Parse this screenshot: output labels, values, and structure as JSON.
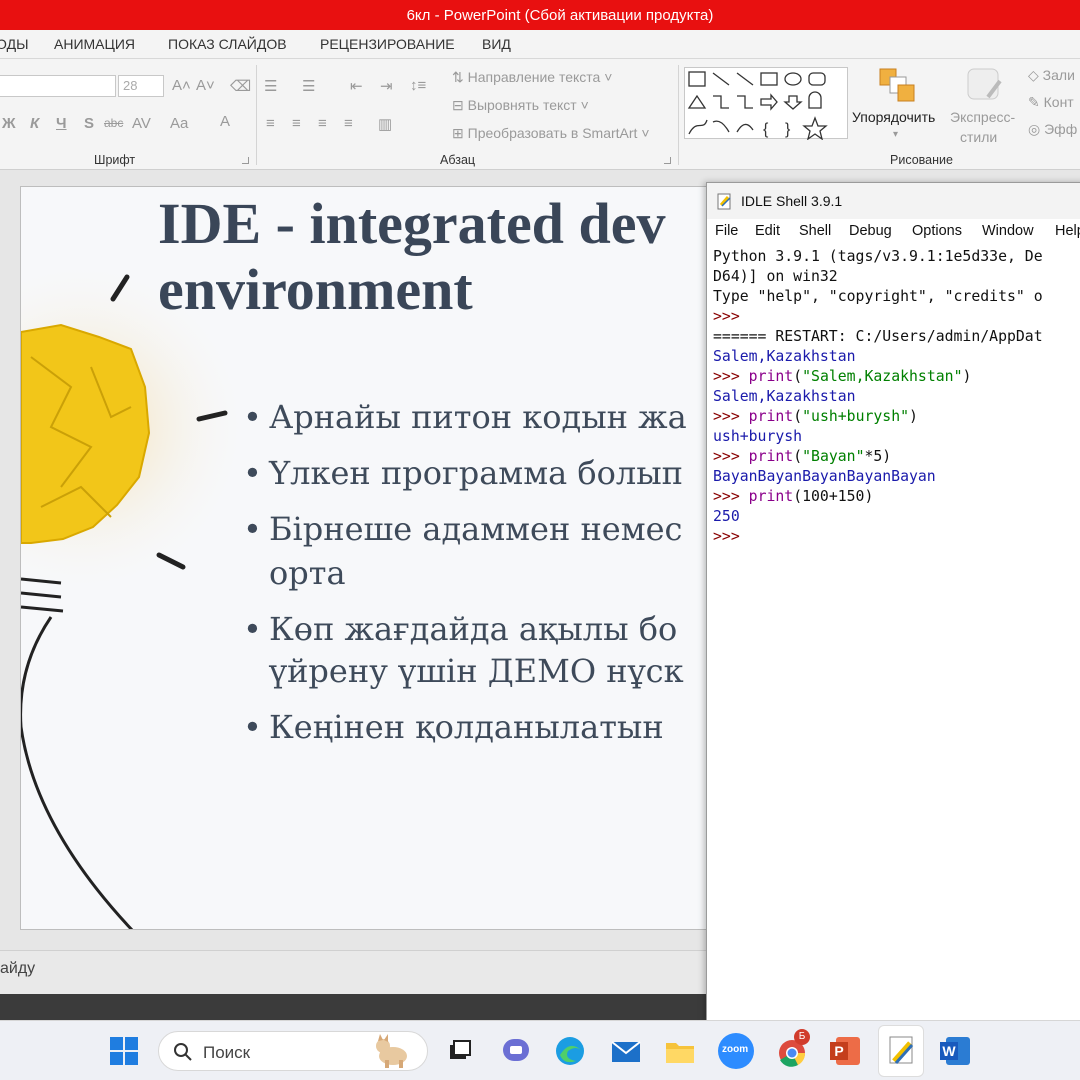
{
  "window_title": "6кл - PowerPoint (Сбой активации продукта)",
  "ribbon_tabs": [
    "ОДЫ",
    "АНИМАЦИЯ",
    "ПОКАЗ СЛАЙДОВ",
    "РЕЦЕНЗИРОВАНИЕ",
    "ВИД"
  ],
  "ribbon": {
    "font_group_label": "Шрифт",
    "font_size": "28",
    "paragraph_group_label": "Абзац",
    "text_direction": "Направление текста",
    "align_text": "Выровнять текст",
    "convert_smartart": "Преобразовать в SmartArt",
    "arrange": "Упорядочить",
    "quick_styles_1": "Экспресс-",
    "quick_styles_2": "стили",
    "drawing_group_label": "Рисование",
    "fill": "Зали",
    "outline": "Конт",
    "effects": "Эфф"
  },
  "slide": {
    "title_line1": "IDE - integrated dev",
    "title_line2": "environment",
    "bullets": [
      "Арнайы питон кодын жа",
      "Үлкен программа болып",
      "Бірнеше адаммен немес",
      "орта",
      "Көп жағдайда ақылы бо",
      "үйрену үшін ДЕМО нұск",
      "Кеңінен қолданылатын"
    ]
  },
  "status_bar": {
    "text": "айду"
  },
  "idle": {
    "title": "IDLE Shell 3.9.1",
    "menu": [
      "File",
      "Edit",
      "Shell",
      "Debug",
      "Options",
      "Window",
      "Help"
    ],
    "banner_1": "Python 3.9.1 (tags/v3.9.1:1e5d33e, De",
    "banner_2": "D64)] on win32",
    "banner_3": "Type \"help\", \"copyright\", \"credits\" o",
    "prompt": ">>>",
    "restart": "====== RESTART: C:/Users/admin/AppDat",
    "output_1": "Salem,Kazakhstan",
    "cmd_1_fn": "print",
    "cmd_1_str": "\"Salem,Kazakhstan\"",
    "output_2": "Salem,Kazakhstan",
    "cmd_2_str": "\"ush+burysh\"",
    "output_3": "ush+burysh",
    "cmd_3_str": "\"Bayan\"",
    "cmd_3_rest": "*5)",
    "output_4": "BayanBayanBayanBayanBayan",
    "cmd_4_rest": "(100+150)",
    "output_5": "250"
  },
  "taskbar": {
    "search_placeholder": "Поиск",
    "zoom_label": "zoom",
    "chrome_badge": "Б",
    "word_letter": "W",
    "ppt_letter": "P"
  }
}
